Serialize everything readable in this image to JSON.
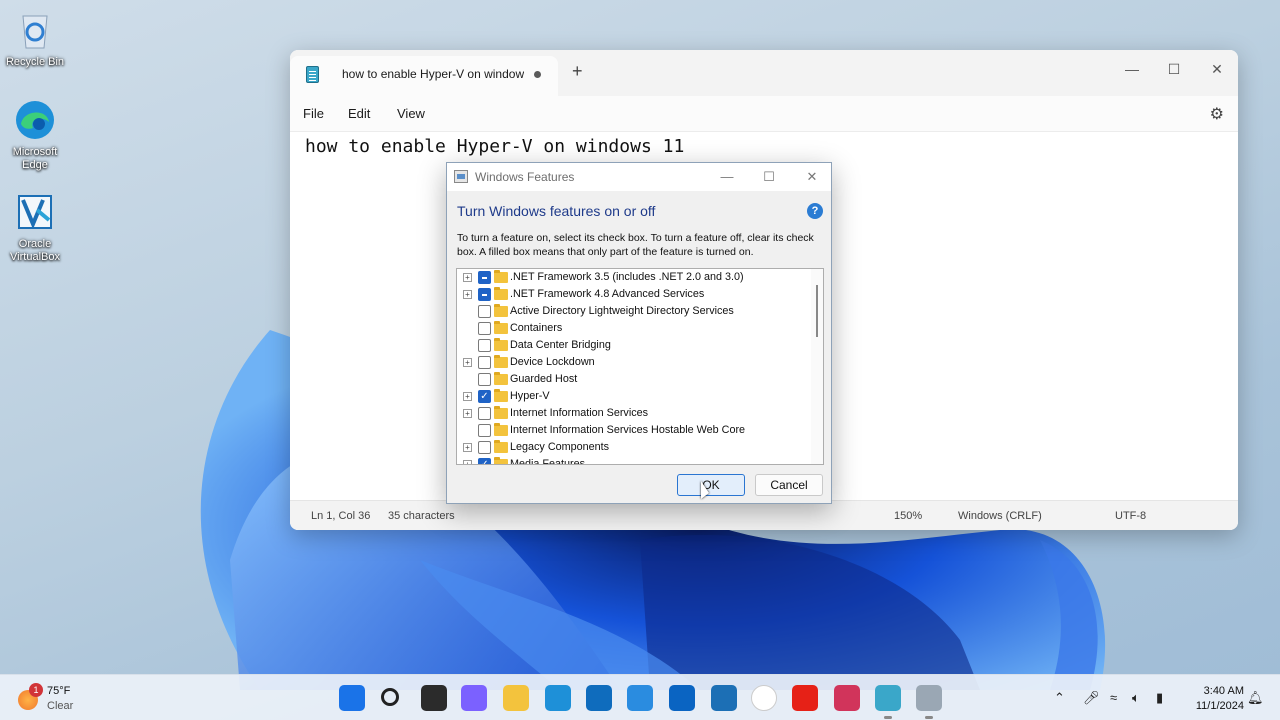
{
  "desktop": {
    "icons": [
      {
        "label": "Recycle Bin"
      },
      {
        "label": "Microsoft Edge"
      },
      {
        "label": "Oracle VirtualBox"
      }
    ]
  },
  "notepad": {
    "tab_title": "how to enable Hyper-V on window",
    "new_tab": "+",
    "menu": {
      "file": "File",
      "edit": "Edit",
      "view": "View"
    },
    "content": "how to enable Hyper-V on windows 11",
    "status": {
      "position": "Ln 1, Col 36",
      "characters": "35 characters",
      "zoom": "150%",
      "line_endings": "Windows (CRLF)",
      "encoding": "UTF-8"
    }
  },
  "dialog": {
    "title": "Windows Features",
    "heading": "Turn Windows features on or off",
    "description": "To turn a feature on, select its check box. To turn a feature off, clear its check box. A filled box means that only part of the feature is turned on.",
    "features": [
      {
        "label": ".NET Framework 3.5 (includes .NET 2.0 and 3.0)",
        "expandable": true,
        "state": "partial"
      },
      {
        "label": ".NET Framework 4.8 Advanced Services",
        "expandable": true,
        "state": "partial"
      },
      {
        "label": "Active Directory Lightweight Directory Services",
        "expandable": false,
        "state": "off"
      },
      {
        "label": "Containers",
        "expandable": false,
        "state": "off"
      },
      {
        "label": "Data Center Bridging",
        "expandable": false,
        "state": "off"
      },
      {
        "label": "Device Lockdown",
        "expandable": true,
        "state": "off"
      },
      {
        "label": "Guarded Host",
        "expandable": false,
        "state": "off"
      },
      {
        "label": "Hyper-V",
        "expandable": true,
        "state": "checked"
      },
      {
        "label": "Internet Information Services",
        "expandable": true,
        "state": "off"
      },
      {
        "label": "Internet Information Services Hostable Web Core",
        "expandable": false,
        "state": "off"
      },
      {
        "label": "Legacy Components",
        "expandable": true,
        "state": "off"
      },
      {
        "label": "Media Features",
        "expandable": true,
        "state": "checked"
      }
    ],
    "ok_label": "OK",
    "cancel_label": "Cancel"
  },
  "taskbar": {
    "weather": {
      "badge": "1",
      "temp": "75°F",
      "condition": "Clear"
    },
    "apps": [
      "start-icon",
      "search-icon",
      "task-view-icon",
      "copilot-icon",
      "file-explorer-icon",
      "edge-icon",
      "store-icon",
      "vscode-icon",
      "outlook-icon",
      "virtualbox-icon",
      "uninstaller-icon",
      "youtube-icon",
      "snipping-tool-icon",
      "notepad-icon",
      "windows-features-icon"
    ],
    "clock": {
      "time": "3:40 AM",
      "date": "11/1/2024"
    }
  },
  "colors": {
    "accent": "#1f63c6",
    "dialog_heading": "#1e3a8a",
    "folder": "#f3c33d"
  }
}
